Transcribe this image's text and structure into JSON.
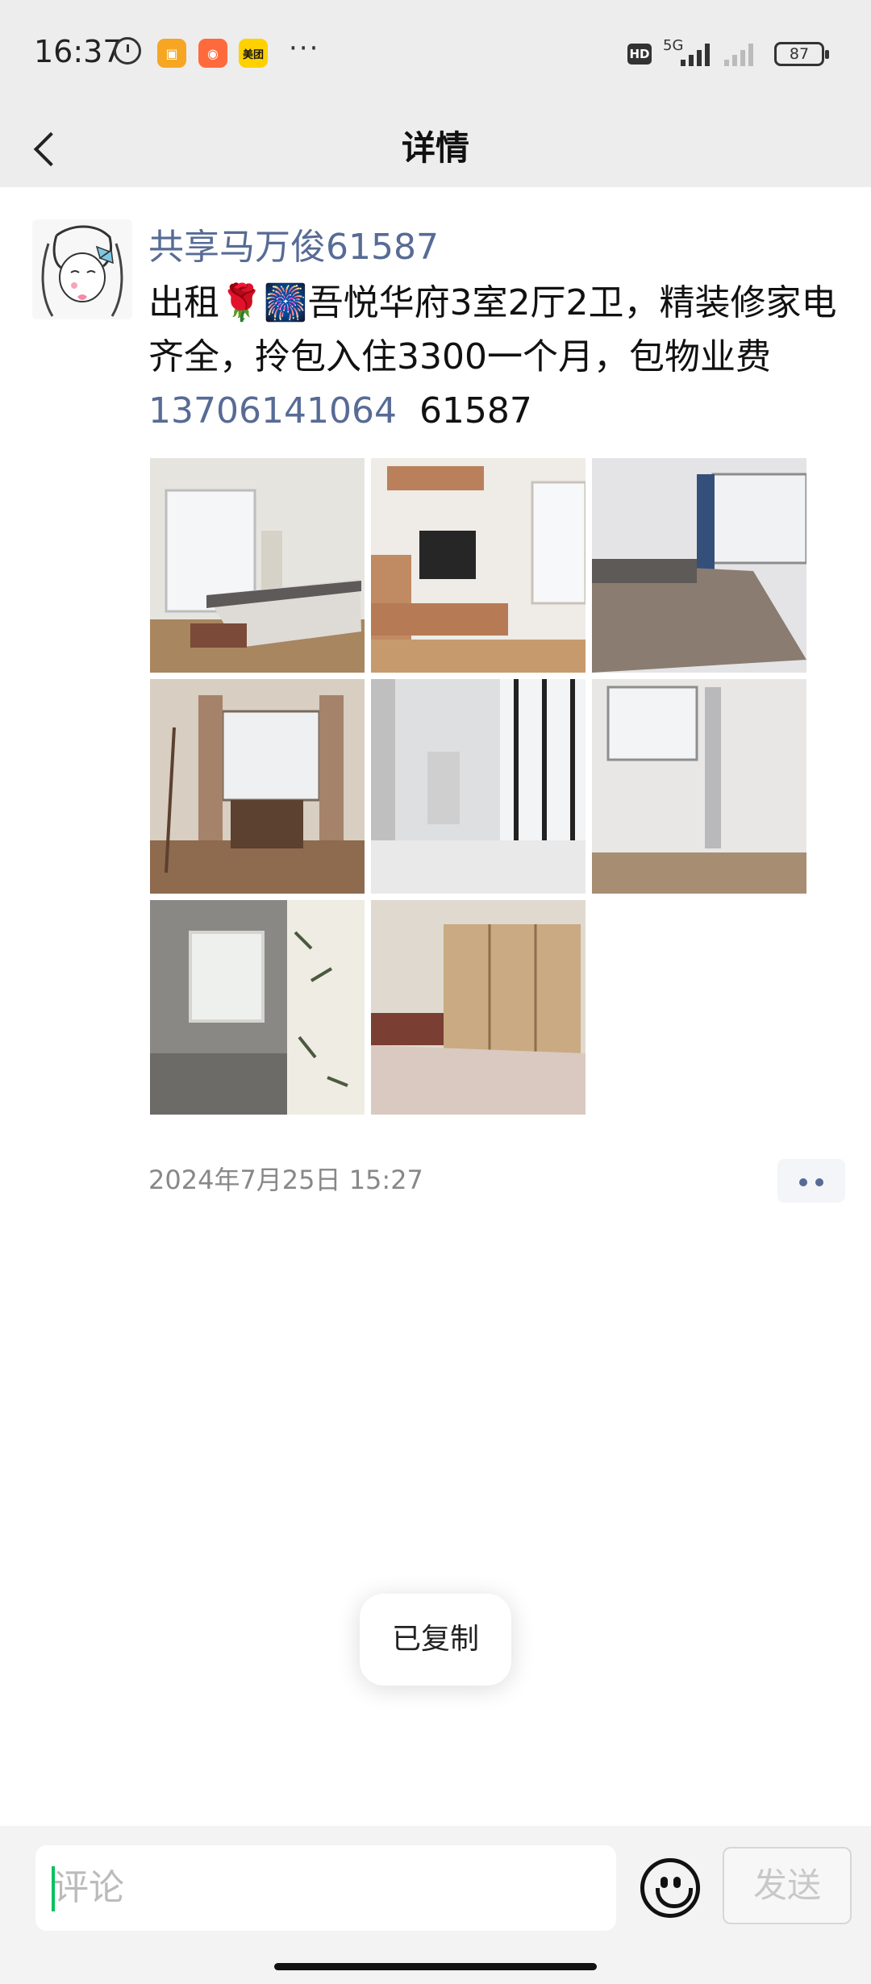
{
  "status_bar": {
    "time": "16:37",
    "app_icons": [
      {
        "name": "message-app-icon",
        "color": "#f6a623",
        "glyph": "▣"
      },
      {
        "name": "shopping-app-icon",
        "color": "#ff6a3d",
        "glyph": "◉"
      },
      {
        "name": "meituan-app-icon",
        "color": "#ffd100",
        "glyph": "美团"
      }
    ],
    "more": "···",
    "hd": "HD",
    "network": "5G",
    "battery": "87"
  },
  "nav": {
    "title": "详情"
  },
  "post": {
    "author": "共享马万俊61587",
    "text_line1": "出租🌹🎆吾悦华府3室2厅2卫，精装修家电齐全，拎包入住3300一个月，包物业费",
    "phone": "13706141064",
    "tail": "61587",
    "photos": [
      {
        "name": "photo-living-room",
        "tones": [
          "#d9d9d6",
          "#e8e6e2",
          "#6e6a6a",
          "#a8865f"
        ]
      },
      {
        "name": "photo-tv-cabinet",
        "tones": [
          "#eeeae4",
          "#b9805b",
          "#2b2b2b",
          "#c79a6d"
        ]
      },
      {
        "name": "photo-bedroom",
        "tones": [
          "#e6e6e8",
          "#8a7c70",
          "#34507a",
          "#b3a79c"
        ]
      },
      {
        "name": "photo-dining-room",
        "tones": [
          "#dcd2c6",
          "#a27858",
          "#5c4030",
          "#cbbcaa"
        ]
      },
      {
        "name": "photo-balcony",
        "tones": [
          "#e0e1e3",
          "#9a9a9a",
          "#2f2f2f",
          "#c9c6c2"
        ]
      },
      {
        "name": "photo-empty-room",
        "tones": [
          "#e7e6e4",
          "#ececeb",
          "#a78e73",
          "#bcbdbf"
        ]
      },
      {
        "name": "photo-bathroom",
        "tones": [
          "#8d8b87",
          "#eae6da",
          "#5a5855",
          "#f2f0ea"
        ]
      },
      {
        "name": "photo-wardrobe",
        "tones": [
          "#ddd6cc",
          "#c6a780",
          "#7a3e32",
          "#d9c9c0"
        ]
      }
    ],
    "timestamp": "2024年7月25日 15:27"
  },
  "toast": "已复制",
  "comment": {
    "placeholder": "评论",
    "send_label": "发送"
  },
  "colors": {
    "link": "#576b95",
    "accent_cursor": "#07c160"
  }
}
